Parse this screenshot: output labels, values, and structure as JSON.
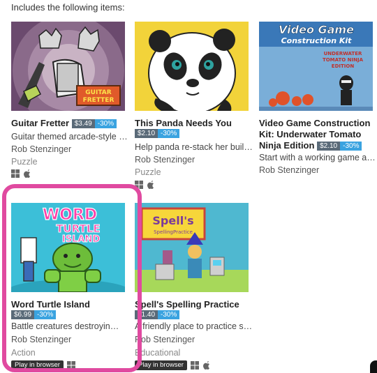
{
  "header": {
    "text": "Includes the following items:"
  },
  "games": [
    {
      "title": "Guitar Fretter",
      "price": "$3.49",
      "discount": "-30%",
      "description": "Guitar themed arcade-style a...",
      "author": "Rob Stenzinger",
      "genre": "Puzzle",
      "platforms": [
        "windows-icon",
        "apple-icon"
      ]
    },
    {
      "title": "This Panda Needs You",
      "price": "$2.10",
      "discount": "-30%",
      "description": "Help panda re-stack her build...",
      "author": "Rob Stenzinger",
      "genre": "Puzzle",
      "platforms": [
        "windows-icon",
        "apple-icon"
      ]
    },
    {
      "title": "Video Game Construction Kit: Underwater Tomato Ninja Edition",
      "price": "$2.10",
      "discount": "-30%",
      "description": "Start with a working game an...",
      "author": "Rob Stenzinger",
      "cover_title": "Video Game",
      "cover_subtitle": "Construction Kit",
      "cover_edition": [
        "UNDERWATER",
        "TOMATO NINJA",
        "EDITION"
      ]
    },
    {
      "title": "Word Turtle Island",
      "price": "$6.99",
      "discount": "-30%",
      "description": "Battle creatures destroying t...",
      "author": "Rob Stenzinger",
      "genre": "Action",
      "play_label": "Play in browser",
      "platforms": [
        "windows-icon"
      ],
      "cover_lines": [
        "WORD",
        "TURTLE",
        "ISLAND"
      ]
    },
    {
      "title": "Spell's Spelling Practice",
      "price": "$1.40",
      "discount": "-30%",
      "description": "A friendly place to practice sp...",
      "author": "Rob Stenzinger",
      "genre": "Educational",
      "play_label": "Play in browser",
      "platforms": [
        "windows-icon",
        "apple-icon"
      ],
      "cover_title": "Spell's",
      "cover_subtitle": "SpellingPractice"
    }
  ],
  "colors": {
    "highlight": "#e04aa0",
    "discount_badge": "#3aa3e0",
    "price_badge": "#5a6a78"
  }
}
